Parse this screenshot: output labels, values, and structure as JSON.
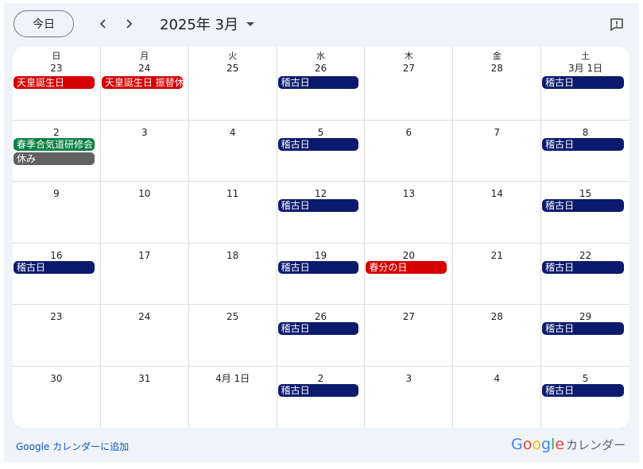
{
  "toolbar": {
    "today_label": "今日",
    "month_label": "2025年 3月"
  },
  "weekdays": [
    "日",
    "月",
    "火",
    "水",
    "木",
    "金",
    "土"
  ],
  "colors": {
    "holiday": "#d50000",
    "keiko": "#0c1a6e",
    "event_green": "#0b8043",
    "rest": "#616161"
  },
  "weeks": [
    [
      {
        "date": "23",
        "events": [
          {
            "title": "天皇誕生日",
            "color": "#d50000"
          }
        ]
      },
      {
        "date": "24",
        "events": [
          {
            "title": "天皇誕生日 振替休日",
            "color": "#d50000"
          }
        ]
      },
      {
        "date": "25",
        "events": []
      },
      {
        "date": "26",
        "events": [
          {
            "title": "稽古日",
            "color": "#0c1a6e"
          }
        ]
      },
      {
        "date": "27",
        "events": []
      },
      {
        "date": "28",
        "events": []
      },
      {
        "date": "3月 1日",
        "events": [
          {
            "title": "稽古日",
            "color": "#0c1a6e"
          }
        ]
      }
    ],
    [
      {
        "date": "2",
        "events": [
          {
            "title": "春季合気道研修会",
            "color": "#0b8043"
          },
          {
            "title": "休み",
            "color": "#616161"
          }
        ]
      },
      {
        "date": "3",
        "events": []
      },
      {
        "date": "4",
        "events": []
      },
      {
        "date": "5",
        "events": [
          {
            "title": "稽古日",
            "color": "#0c1a6e"
          }
        ]
      },
      {
        "date": "6",
        "events": []
      },
      {
        "date": "7",
        "events": []
      },
      {
        "date": "8",
        "events": [
          {
            "title": "稽古日",
            "color": "#0c1a6e"
          }
        ]
      }
    ],
    [
      {
        "date": "9",
        "events": []
      },
      {
        "date": "10",
        "events": []
      },
      {
        "date": "11",
        "events": []
      },
      {
        "date": "12",
        "events": [
          {
            "title": "稽古日",
            "color": "#0c1a6e"
          }
        ]
      },
      {
        "date": "13",
        "events": []
      },
      {
        "date": "14",
        "events": []
      },
      {
        "date": "15",
        "events": [
          {
            "title": "稽古日",
            "color": "#0c1a6e"
          }
        ]
      }
    ],
    [
      {
        "date": "16",
        "events": [
          {
            "title": "稽古日",
            "color": "#0c1a6e"
          }
        ]
      },
      {
        "date": "17",
        "events": []
      },
      {
        "date": "18",
        "events": []
      },
      {
        "date": "19",
        "events": [
          {
            "title": "稽古日",
            "color": "#0c1a6e"
          }
        ]
      },
      {
        "date": "20",
        "events": [
          {
            "title": "春分の日",
            "color": "#d50000"
          }
        ]
      },
      {
        "date": "21",
        "events": []
      },
      {
        "date": "22",
        "events": [
          {
            "title": "稽古日",
            "color": "#0c1a6e"
          }
        ]
      }
    ],
    [
      {
        "date": "23",
        "events": []
      },
      {
        "date": "24",
        "events": []
      },
      {
        "date": "25",
        "events": []
      },
      {
        "date": "26",
        "events": [
          {
            "title": "稽古日",
            "color": "#0c1a6e"
          }
        ]
      },
      {
        "date": "27",
        "events": []
      },
      {
        "date": "28",
        "events": []
      },
      {
        "date": "29",
        "events": [
          {
            "title": "稽古日",
            "color": "#0c1a6e"
          }
        ]
      }
    ],
    [
      {
        "date": "30",
        "events": []
      },
      {
        "date": "31",
        "events": []
      },
      {
        "date": "4月 1日",
        "events": []
      },
      {
        "date": "2",
        "events": [
          {
            "title": "稽古日",
            "color": "#0c1a6e"
          }
        ]
      },
      {
        "date": "3",
        "events": []
      },
      {
        "date": "4",
        "events": []
      },
      {
        "date": "5",
        "events": [
          {
            "title": "稽古日",
            "color": "#0c1a6e"
          }
        ]
      }
    ]
  ],
  "footer": {
    "add_link": "Google カレンダーに追加",
    "brand_google": "Google",
    "brand_calendar": "カレンダー"
  }
}
